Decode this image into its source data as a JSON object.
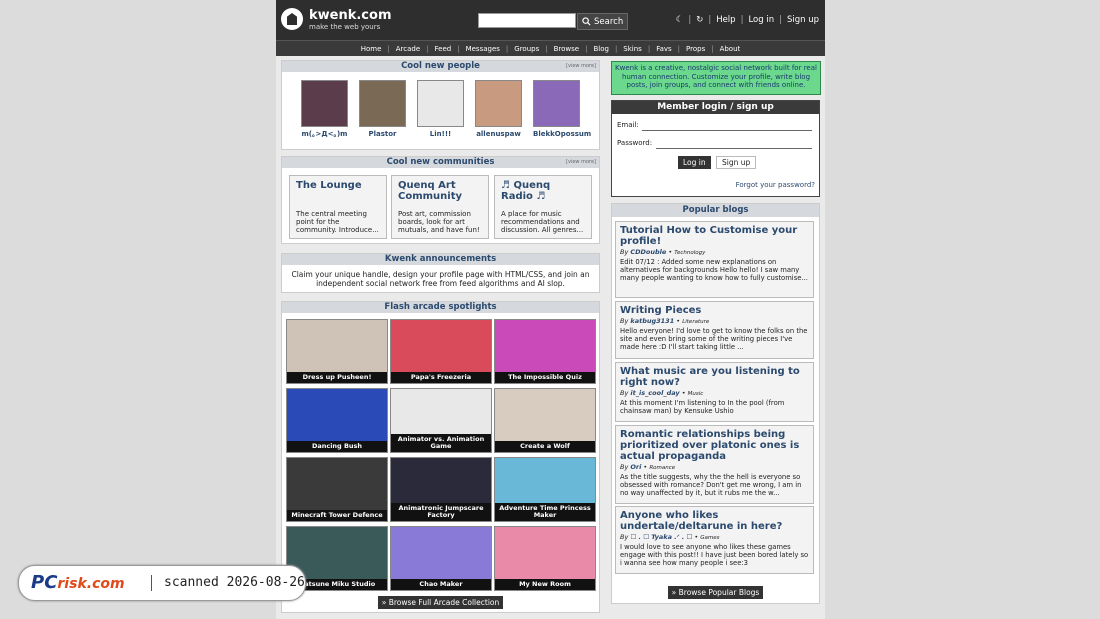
{
  "header": {
    "site_name": "kwenk.com",
    "tagline": "make the web yours",
    "search_value": "",
    "search_label": "Search",
    "links": [
      "Help",
      "Log in",
      "Sign up"
    ]
  },
  "nav": [
    "Home",
    "Arcade",
    "Feed",
    "Messages",
    "Groups",
    "Browse",
    "Blog",
    "Skins",
    "Favs",
    "Props",
    "About"
  ],
  "people": {
    "title": "Cool new people",
    "view_more": "[view more]",
    "items": [
      {
        "name": "m(｡>Д<｡)m",
        "color": "#5a3c4a"
      },
      {
        "name": "Plastor",
        "color": "#7a6a55"
      },
      {
        "name": "Lin!!!",
        "color": "#e8e8e8"
      },
      {
        "name": "allenuspaw",
        "color": "#c89a80"
      },
      {
        "name": "BlekkOpossum",
        "color": "#8a6ab8"
      }
    ]
  },
  "communities": {
    "title": "Cool new communities",
    "view_more": "[view more]",
    "items": [
      {
        "title": "The Lounge",
        "desc": "The central meeting point for the community. Introduce..."
      },
      {
        "title": "Quenq Art Community",
        "desc": "Post art, commission boards, look for art mutuals, and have fun!"
      },
      {
        "title": "♬ Quenq Radio ♬",
        "desc": "A place for music recommendations and discussion. All genres..."
      }
    ]
  },
  "announcements": {
    "title": "Kwenk announcements",
    "text": "Claim your unique handle, design your profile page with HTML/CSS, and join an independent social network free from feed algorithms and AI slop."
  },
  "arcade": {
    "title": "Flash arcade spotlights",
    "games": [
      {
        "name": "Dress up Pusheen!",
        "color": "#cfc3b8"
      },
      {
        "name": "Papa's Freezeria",
        "color": "#d94a5a"
      },
      {
        "name": "The Impossible Quiz",
        "color": "#c94ab8"
      },
      {
        "name": "Dancing Bush",
        "color": "#2a4ab8"
      },
      {
        "name": "Animator vs. Animation Game",
        "color": "#e8e8e8"
      },
      {
        "name": "Create a Wolf",
        "color": "#d8ccc0"
      },
      {
        "name": "Minecraft Tower Defence",
        "color": "#3a3a3a"
      },
      {
        "name": "Animatronic Jumpscare Factory",
        "color": "#2a2a3a"
      },
      {
        "name": "Adventure Time Princess Maker",
        "color": "#6ab8d8"
      },
      {
        "name": "Hatsune Miku Studio",
        "color": "#3a5a5a"
      },
      {
        "name": "Chao Maker",
        "color": "#8a7ad8"
      },
      {
        "name": "My New Room",
        "color": "#e88aa8"
      }
    ],
    "browse_label": "» Browse Full Arcade Collection"
  },
  "intro": "Kwenk is a creative, nostalgic social network built for real human connection. Customize your profile, write blog posts, join groups, and connect with friends online.",
  "login": {
    "title": "Member login / sign up",
    "email_label": "Email:",
    "password_label": "Password:",
    "login_button": "Log in",
    "signup_button": "Sign up",
    "forgot": "Forgot your password?"
  },
  "blogs": {
    "title": "Popular blogs",
    "items": [
      {
        "title": "Tutorial How to Customise your profile!",
        "author": "CDDouble",
        "category": "Technology",
        "excerpt": "Edit 07/12 : Added some new explanations on alternatives for backgrounds Hello hello! I saw many many people wanting to know how to fully customise..."
      },
      {
        "title": "Writing Pieces",
        "author": "katbug3131",
        "category": "Literature",
        "excerpt": "Hello everyone! I'd love to get to know the folks on the site and even bring some of the writing pieces I've made here :D I'll start taking little ..."
      },
      {
        "title": "What music are you listening to right now?",
        "author": "it_is_cool_day",
        "category": "Music",
        "excerpt": "At this moment I'm listening to In the pool (from chainsaw man) by Kensuke Ushio"
      },
      {
        "title": "Romantic relationships being prioritized over platonic ones is actual propaganda",
        "author": "Ori",
        "category": "Romance",
        "excerpt": "As the title suggests, why the the hell is everyone so obsessed with romance? Don't get me wrong, I am in no way unaffected by it, but it rubs me the w..."
      },
      {
        "title": "Anyone who likes undertale/deltarune in here?",
        "author": "☐ . ☐ Tyaka .ᐟ . ☐",
        "category": "Games",
        "excerpt": "I would love to see anyone who likes these games engage with this post!! I have just been bored lately so i wanna see how many people i see:3"
      }
    ],
    "browse_label": "» Browse Popular Blogs"
  },
  "watermark": {
    "brand": "PC",
    "brand2": "risk.com",
    "text": "scanned 2026-08-26"
  }
}
